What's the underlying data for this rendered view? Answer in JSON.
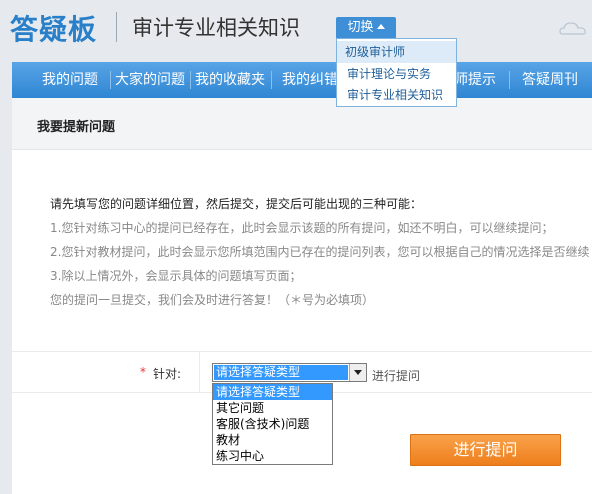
{
  "header": {
    "logo": "答疑板",
    "title": "审计专业相关知识",
    "switch_label": "切换"
  },
  "switch_menu": [
    "初级审计师",
    "审计理论与实务",
    "审计专业相关知识"
  ],
  "nav": [
    "我的问题",
    "大家的问题",
    "我的收藏夹",
    "我的纠错",
    "师提示",
    "答疑周刊"
  ],
  "section": {
    "title": "我要提新问题"
  },
  "notice": {
    "title": "请先填写您的问题详细位置，然后提交，提交后可能出现的三种可能：",
    "lines": [
      "1.您针对练习中心的提问已经存在，此时会显示该题的所有提问，如还不明白，可以继续提问；",
      "2.您针对教材提问，此时会显示您所填范围内已存在的提问列表，您可以根据自己的情况选择是否继续",
      "3.除以上情况外，会显示具体的问题填写页面；",
      "您的提问一旦提交，我们会及时进行答复！（＊号为必填项）"
    ]
  },
  "form": {
    "required_mark": "*",
    "label": "针对:",
    "selected": "请选择答疑类型",
    "after_text": "进行提问",
    "options": [
      "请选择答疑类型",
      "其它问题",
      "客服(含技术)问题",
      "教材",
      "练习中心"
    ]
  },
  "submit_label": "进行提问",
  "colors": {
    "brand_blue": "#2a7fc9",
    "nav_blue": "#2f86d3",
    "submit_orange": "#ee7e1c",
    "select_highlight": "#3399ff"
  }
}
